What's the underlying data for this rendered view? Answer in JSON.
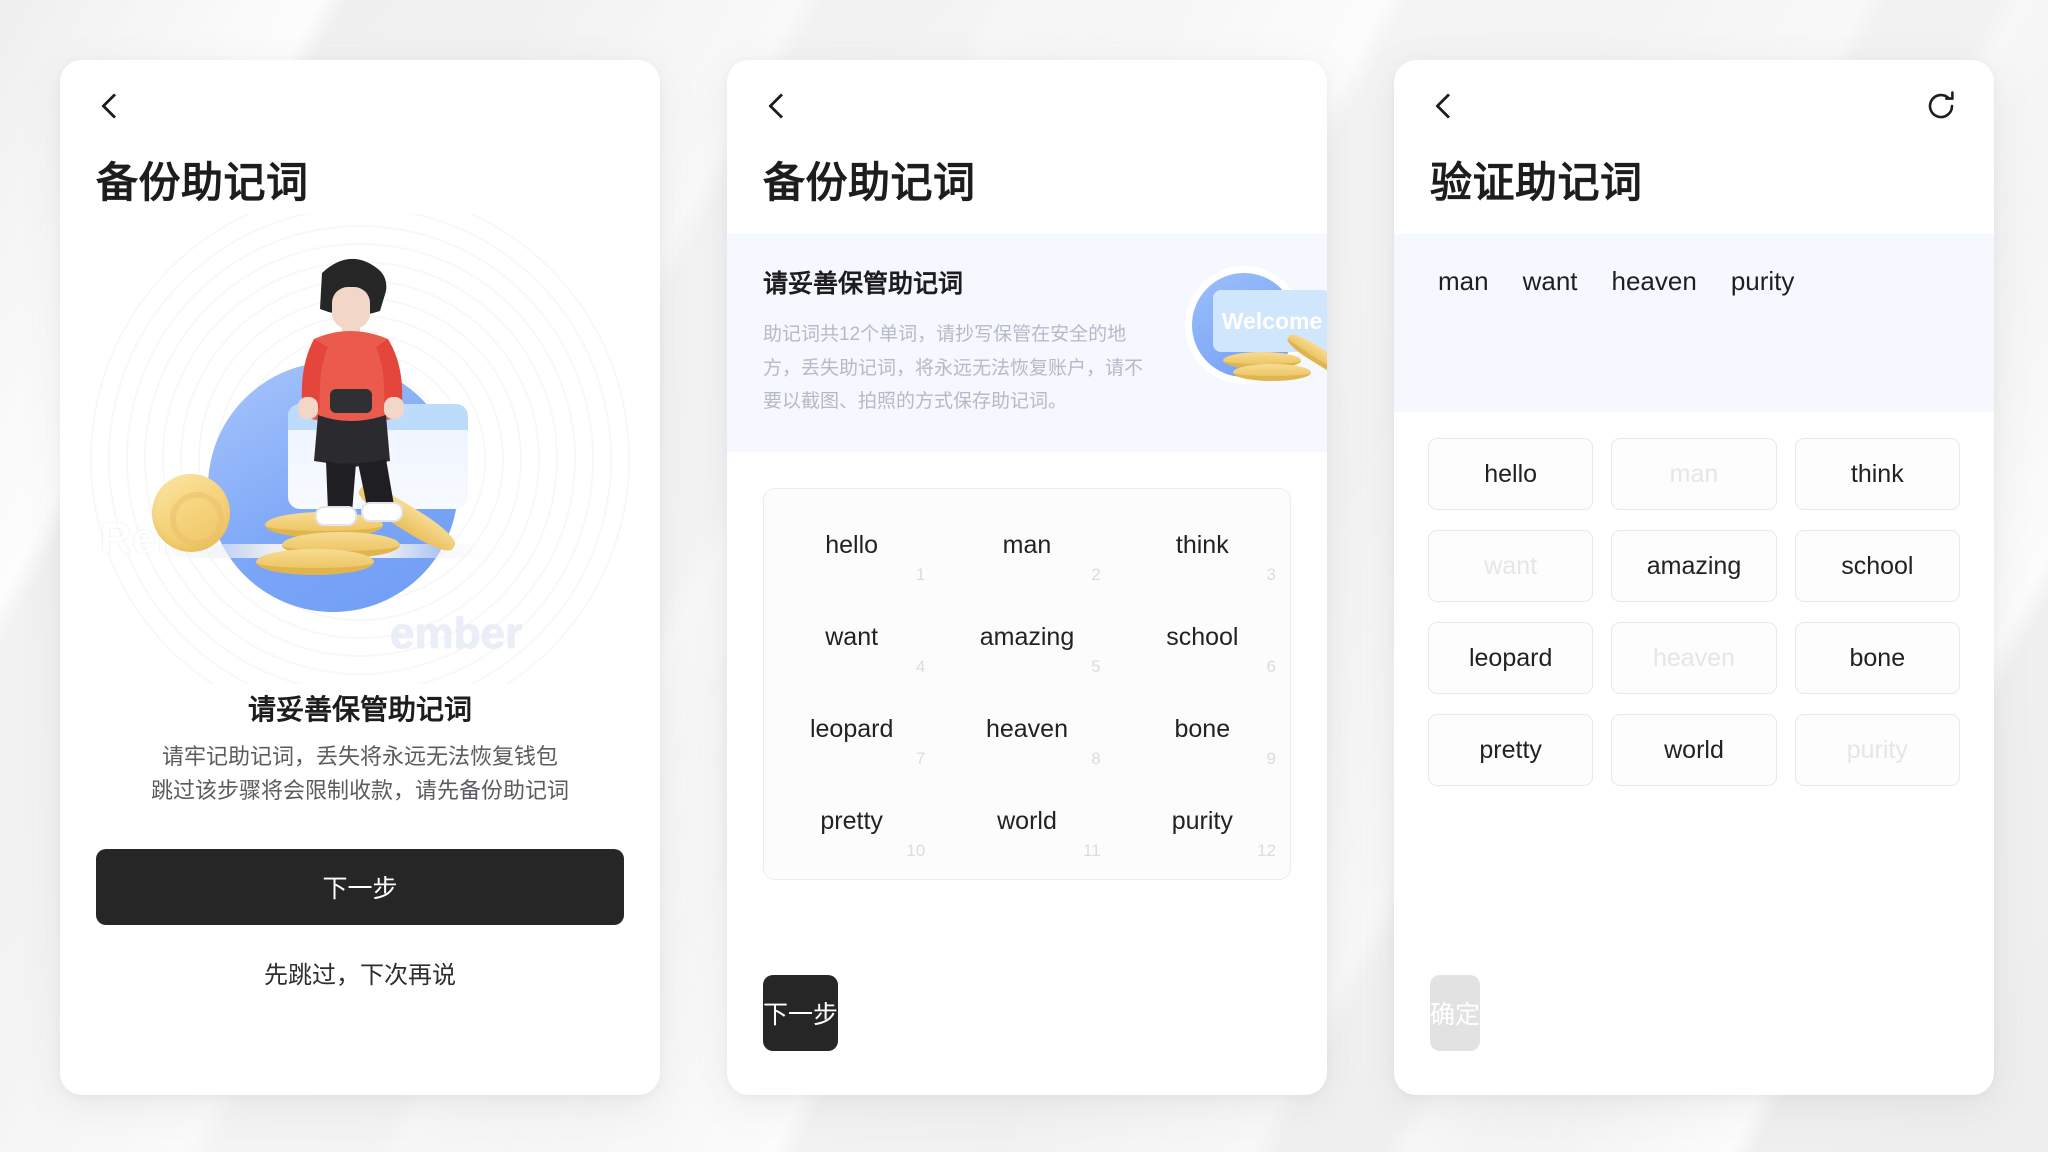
{
  "panel1": {
    "nav": {
      "back_icon": "chevron-left-icon"
    },
    "title": "备份助记词",
    "illustration": {
      "ghost_word_a": "Remember",
      "ghost_word_b": "ember"
    },
    "heading": "请妥善保管助记词",
    "sub_line1": "请牢记助记词，丢失将永远无法恢复钱包",
    "sub_line2": "跳过该步骤将会限制收款，请先备份助记词",
    "primary_button": "下一步",
    "skip_link": "先跳过，下次再说"
  },
  "panel2": {
    "nav": {
      "back_icon": "chevron-left-icon"
    },
    "title": "备份助记词",
    "notice": {
      "title": "请妥善保管助记词",
      "body": "助记词共12个单词，请抄写保管在安全的地方，丢失助记词，将永远无法恢复账户，请不要以截图、拍照的方式保存助记词。",
      "art_card_text": "Welcome"
    },
    "words": [
      {
        "index": "1",
        "word": "hello"
      },
      {
        "index": "2",
        "word": "man"
      },
      {
        "index": "3",
        "word": "think"
      },
      {
        "index": "4",
        "word": "want"
      },
      {
        "index": "5",
        "word": "amazing"
      },
      {
        "index": "6",
        "word": "school"
      },
      {
        "index": "7",
        "word": "leopard"
      },
      {
        "index": "8",
        "word": "heaven"
      },
      {
        "index": "9",
        "word": "bone"
      },
      {
        "index": "10",
        "word": "pretty"
      },
      {
        "index": "11",
        "word": "world"
      },
      {
        "index": "12",
        "word": "purity"
      }
    ],
    "primary_button": "下一步"
  },
  "panel3": {
    "nav": {
      "back_icon": "chevron-left-icon",
      "refresh_icon": "refresh-icon"
    },
    "title": "验证助记词",
    "selected_words": [
      "man",
      "want",
      "heaven",
      "purity"
    ],
    "chips": [
      {
        "word": "hello",
        "used": false
      },
      {
        "word": "man",
        "used": true
      },
      {
        "word": "think",
        "used": false
      },
      {
        "word": "want",
        "used": true
      },
      {
        "word": "amazing",
        "used": false
      },
      {
        "word": "school",
        "used": false
      },
      {
        "word": "leopard",
        "used": false
      },
      {
        "word": "heaven",
        "used": true
      },
      {
        "word": "bone",
        "used": false
      },
      {
        "word": "pretty",
        "used": false
      },
      {
        "word": "world",
        "used": false
      },
      {
        "word": "purity",
        "used": true
      }
    ],
    "confirm_button": "确定",
    "confirm_enabled": false
  },
  "colors": {
    "primary_button_bg": "#262626",
    "disabled_button_bg": "#e2e2e2",
    "notice_bg": "#f5f8fe",
    "accent_blue": "#6f9ef6",
    "coin_gold": "#edc665",
    "page_bg": "#f0f0f0"
  }
}
